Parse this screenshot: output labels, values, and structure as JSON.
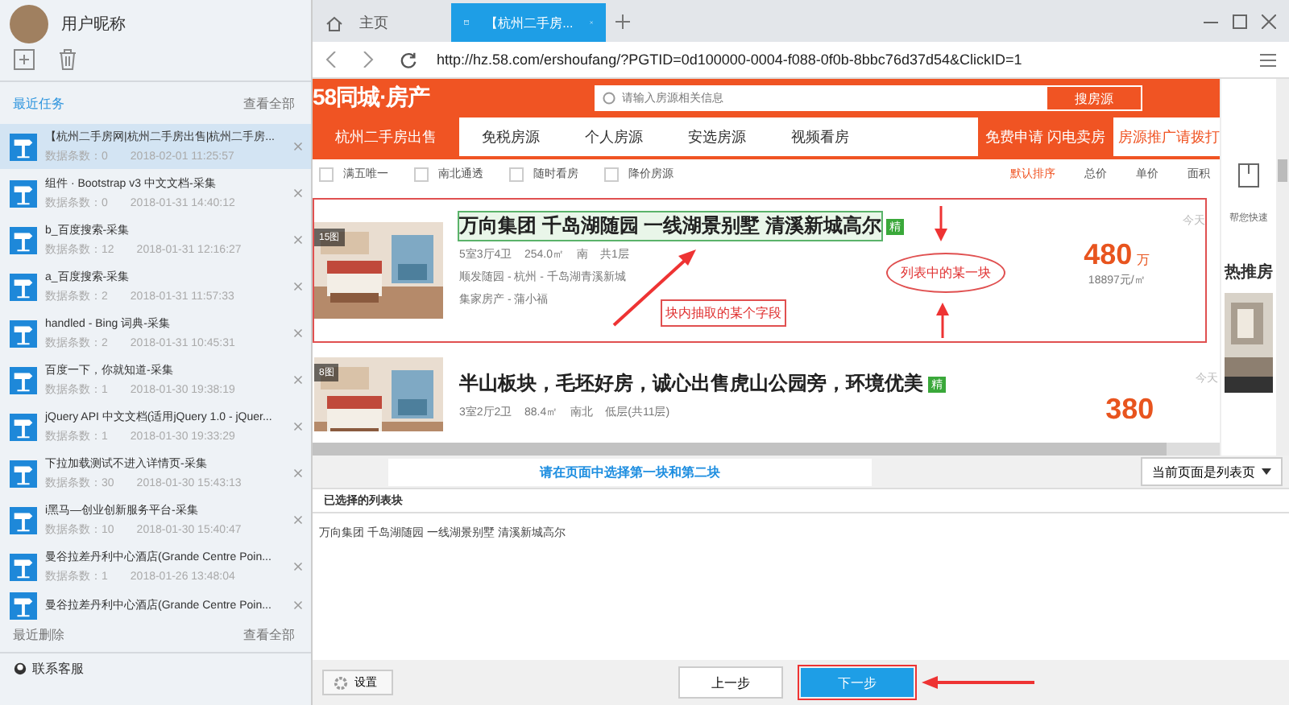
{
  "sidebar": {
    "user_name": "用户昵称",
    "recent_title": "最近任务",
    "recent_more": "查看全部",
    "tasks": [
      {
        "title": "【杭州二手房网|杭州二手房出售|杭州二手房...",
        "count": "数据条数：0",
        "time": "2018-02-01 11:25:57",
        "selected": true
      },
      {
        "title": "组件 · Bootstrap v3 中文文档-采集",
        "count": "数据条数：0",
        "time": "2018-01-31 14:40:12",
        "selected": false
      },
      {
        "title": "b_百度搜索-采集",
        "count": "数据条数：12",
        "time": "2018-01-31 12:16:27",
        "selected": false
      },
      {
        "title": "a_百度搜索-采集",
        "count": "数据条数：2",
        "time": "2018-01-31 11:57:33",
        "selected": false
      },
      {
        "title": "handled - Bing 词典-采集",
        "count": "数据条数：2",
        "time": "2018-01-31 10:45:31",
        "selected": false
      },
      {
        "title": "百度一下，你就知道-采集",
        "count": "数据条数：1",
        "time": "2018-01-30 19:38:19",
        "selected": false
      },
      {
        "title": "jQuery API 中文文档(适用jQuery 1.0 - jQuer...",
        "count": "数据条数：1",
        "time": "2018-01-30 19:33:29",
        "selected": false
      },
      {
        "title": "下拉加载测试不进入详情页-采集",
        "count": "数据条数：30",
        "time": "2018-01-30 15:43:13",
        "selected": false
      },
      {
        "title": "i黑马—创业创新服务平台-采集",
        "count": "数据条数：10",
        "time": "2018-01-30 15:40:47",
        "selected": false
      },
      {
        "title": "曼谷拉差丹利中心酒店(Grande Centre Poin...",
        "count": "数据条数：1",
        "time": "2018-01-26 13:48:04",
        "selected": false
      },
      {
        "title": "曼谷拉差丹利中心酒店(Grande Centre Poin...",
        "selected": false
      }
    ],
    "deleted_title": "最近删除",
    "deleted_more": "查看全部",
    "support": "联系客服"
  },
  "browser": {
    "tabs": [
      {
        "label": "主页",
        "kind": "home",
        "selected": false
      },
      {
        "label": "【杭州二手房...",
        "kind": "page",
        "selected": true
      }
    ],
    "url": "http://hz.58.com/ershoufang/?PGTID=0d100000-0004-f088-0f0b-8bbc76d37d54&ClickID=1"
  },
  "site": {
    "logo": "58同城·房产",
    "search_placeholder": "请输入房源相关信息",
    "search_button": "搜房源",
    "nav": [
      {
        "label": "杭州二手房出售",
        "selected": true
      },
      {
        "label": "免税房源",
        "selected": false
      },
      {
        "label": "个人房源",
        "selected": false
      },
      {
        "label": "安选房源",
        "selected": false
      },
      {
        "label": "视频看房",
        "selected": false
      }
    ],
    "promo": "免费申请 闪电卖房",
    "promo_phone": "房源推广请拨打",
    "filters": [
      {
        "label": "满五唯一",
        "checked": false
      },
      {
        "label": "南北通透",
        "checked": false
      },
      {
        "label": "随时看房",
        "checked": false
      },
      {
        "label": "降价房源",
        "checked": false
      }
    ],
    "sorts": [
      {
        "label": "默认排序",
        "selected": true
      },
      {
        "label": "总价",
        "selected": false
      },
      {
        "label": "单价",
        "selected": false
      },
      {
        "label": "面积",
        "selected": false
      }
    ],
    "listings": [
      {
        "badge": "15图",
        "title": "万向集团 千岛湖随园 一线湖景别墅 清溪新城高尔",
        "tag": "精",
        "details": "5室3厅4卫    254.0㎡    南    共1层",
        "lines": [
          "顺发随园 - 杭州 - 千岛湖青溪新城",
          "集家房产 - 蒲小福"
        ],
        "time": "今天",
        "price": "480",
        "unit": "万",
        "unit_price": "18897元/㎡",
        "selected": true
      },
      {
        "badge": "8图",
        "title": "半山板块，毛坯好房，诚心出售虎山公园旁，环境优美",
        "tag": "精",
        "details": "3室2厅2卫    88.4㎡    南北    低层(共11层)",
        "time": "今天",
        "price": "380",
        "selected": false
      }
    ],
    "side_text": "帮您快速",
    "side_heading": "热推房"
  },
  "annotations": {
    "field_note": "块内抽取的某个字段",
    "block_note": "列表中的某一块"
  },
  "hint": "请在页面中选择第一块和第二块",
  "page_type": "当前页面是列表页",
  "selected_panel": {
    "title": "已选择的列表块",
    "content": "万向集团 千岛湖随园 一线湖景别墅 清溪新城高尔"
  },
  "buttons": {
    "settings": "设置",
    "prev": "上一步",
    "next": "下一步"
  }
}
